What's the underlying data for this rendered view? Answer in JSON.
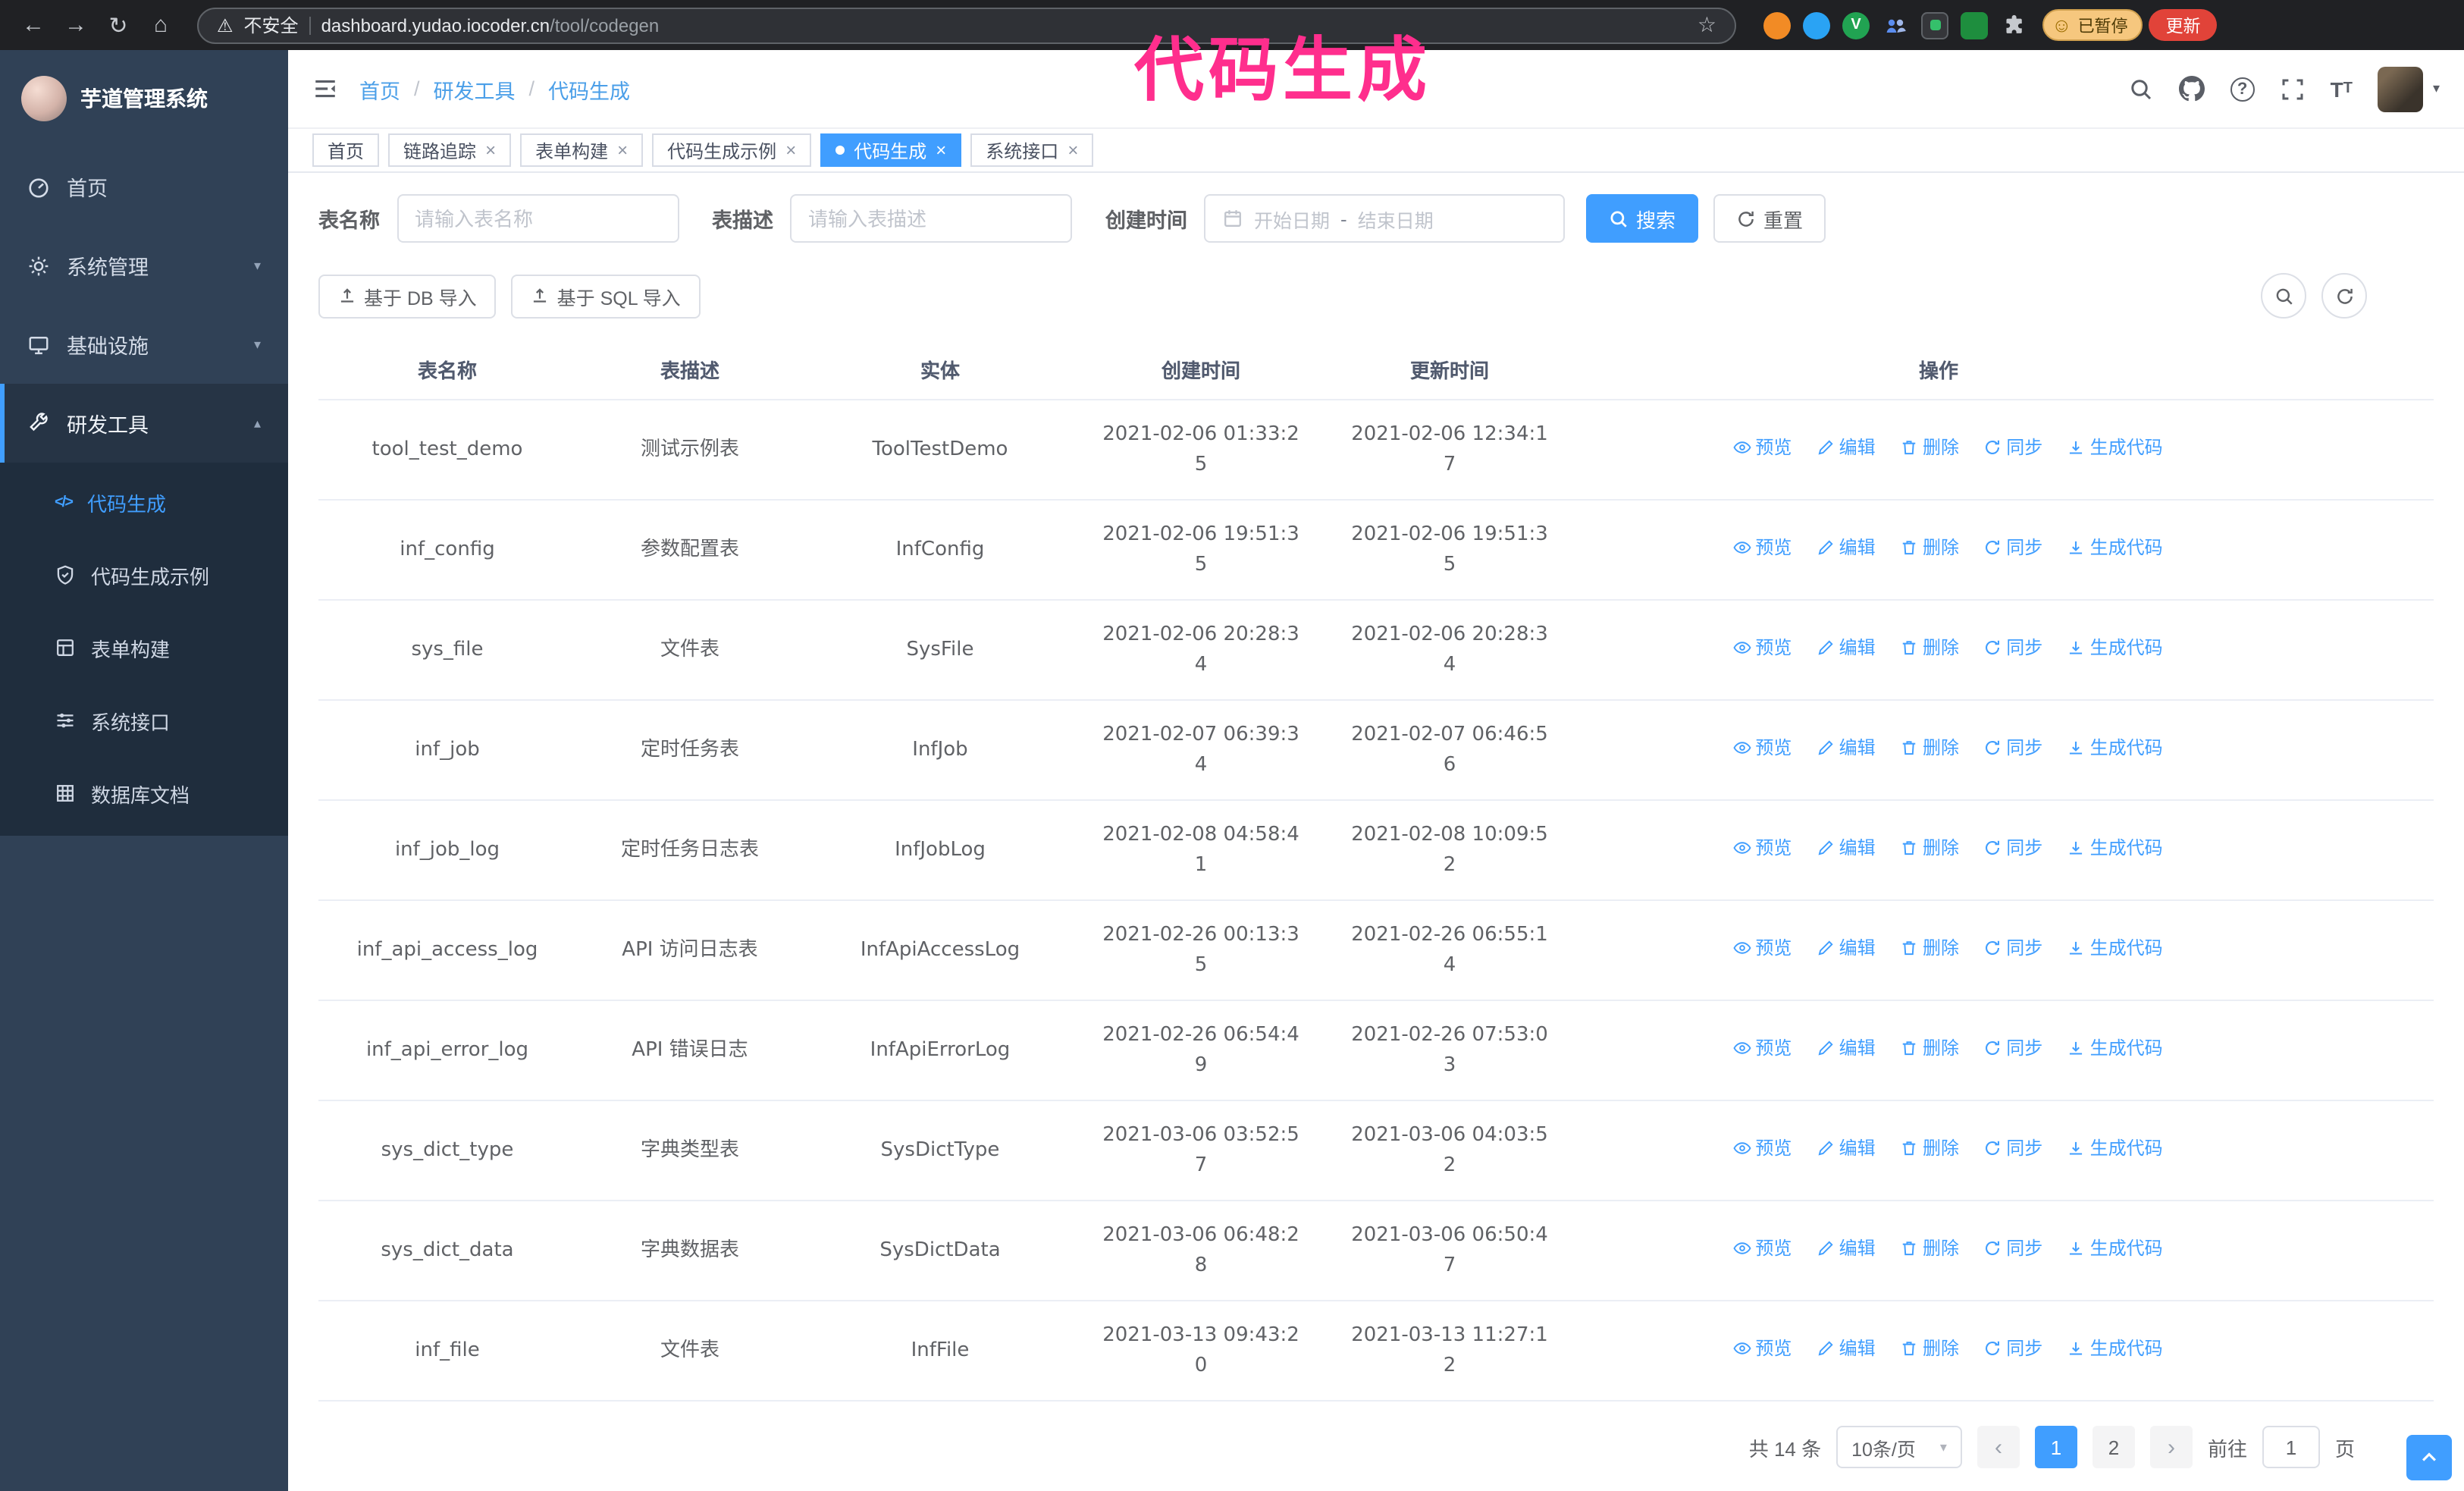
{
  "annotation": "代码生成",
  "icons": {
    "back": "←",
    "forward": "→",
    "reload": "↻",
    "home": "⌂",
    "warning": "⚠",
    "star": "☆",
    "smiley": "☺",
    "v": "V",
    "caret_down": "▾",
    "caret_up": "▴",
    "close": "×",
    "code": "</>",
    "question": "?",
    "dash": "-",
    "chevron_left": "‹",
    "chevron_right": "›",
    "font_large": "T",
    "font_small": "T"
  },
  "browser": {
    "security_label": "不安全",
    "url_host": "dashboard.yudao.iocoder.cn",
    "url_path": "/tool/codegen",
    "paused_badge": "已暂停",
    "update_button": "更新"
  },
  "sidebar": {
    "app_title": "芋道管理系统",
    "items": [
      {
        "label": "首页"
      },
      {
        "label": "系统管理"
      },
      {
        "label": "基础设施"
      },
      {
        "label": "研发工具"
      }
    ],
    "submenu": [
      {
        "label": "代码生成"
      },
      {
        "label": "代码生成示例"
      },
      {
        "label": "表单构建"
      },
      {
        "label": "系统接口"
      },
      {
        "label": "数据库文档"
      }
    ]
  },
  "breadcrumb": [
    "首页",
    "研发工具",
    "代码生成"
  ],
  "tabs": [
    {
      "label": "首页"
    },
    {
      "label": "链路追踪"
    },
    {
      "label": "表单构建"
    },
    {
      "label": "代码生成示例"
    },
    {
      "label": "代码生成"
    },
    {
      "label": "系统接口"
    }
  ],
  "filters": {
    "table_name_label": "表名称",
    "table_name_placeholder": "请输入表名称",
    "table_desc_label": "表描述",
    "table_desc_placeholder": "请输入表描述",
    "create_time_label": "创建时间",
    "date_start_placeholder": "开始日期",
    "date_end_placeholder": "结束日期",
    "search_button": "搜索",
    "reset_button": "重置"
  },
  "toolbar": {
    "import_db_button": "基于 DB 导入",
    "import_sql_button": "基于 SQL 导入"
  },
  "table": {
    "columns": [
      "表名称",
      "表描述",
      "实体",
      "创建时间",
      "更新时间",
      "操作"
    ],
    "ops": [
      "预览",
      "编辑",
      "删除",
      "同步",
      "生成代码"
    ],
    "rows": [
      {
        "name": "tool_test_demo",
        "desc": "测试示例表",
        "entity": "ToolTestDemo",
        "created": "2021-02-06 01:33:25",
        "updated": "2021-02-06 12:34:17"
      },
      {
        "name": "inf_config",
        "desc": "参数配置表",
        "entity": "InfConfig",
        "created": "2021-02-06 19:51:35",
        "updated": "2021-02-06 19:51:35"
      },
      {
        "name": "sys_file",
        "desc": "文件表",
        "entity": "SysFile",
        "created": "2021-02-06 20:28:34",
        "updated": "2021-02-06 20:28:34"
      },
      {
        "name": "inf_job",
        "desc": "定时任务表",
        "entity": "InfJob",
        "created": "2021-02-07 06:39:34",
        "updated": "2021-02-07 06:46:56"
      },
      {
        "name": "inf_job_log",
        "desc": "定时任务日志表",
        "entity": "InfJobLog",
        "created": "2021-02-08 04:58:41",
        "updated": "2021-02-08 10:09:52"
      },
      {
        "name": "inf_api_access_log",
        "desc": "API 访问日志表",
        "entity": "InfApiAccessLog",
        "created": "2021-02-26 00:13:35",
        "updated": "2021-02-26 06:55:14"
      },
      {
        "name": "inf_api_error_log",
        "desc": "API 错误日志",
        "entity": "InfApiErrorLog",
        "created": "2021-02-26 06:54:49",
        "updated": "2021-02-26 07:53:03"
      },
      {
        "name": "sys_dict_type",
        "desc": "字典类型表",
        "entity": "SysDictType",
        "created": "2021-03-06 03:52:57",
        "updated": "2021-03-06 04:03:52"
      },
      {
        "name": "sys_dict_data",
        "desc": "字典数据表",
        "entity": "SysDictData",
        "created": "2021-03-06 06:48:28",
        "updated": "2021-03-06 06:50:47"
      },
      {
        "name": "inf_file",
        "desc": "文件表",
        "entity": "InfFile",
        "created": "2021-03-13 09:43:20",
        "updated": "2021-03-13 11:27:12"
      }
    ]
  },
  "pagination": {
    "total": "共 14 条",
    "page_size": "10条/页",
    "pages": [
      "1",
      "2"
    ],
    "goto_label": "前往",
    "goto_value": "1",
    "goto_suffix": "页"
  }
}
